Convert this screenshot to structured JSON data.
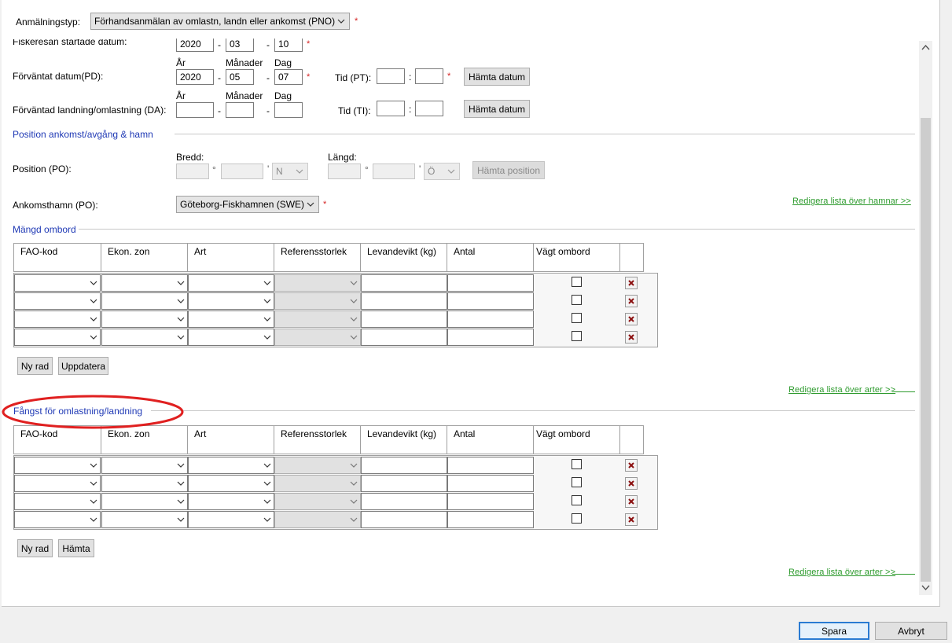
{
  "header": {
    "type_label": "Anmälningstyp:",
    "type_value": "Förhandsanmälan av omlastn, landn eller ankomst (PNO)"
  },
  "start_date": {
    "label": "Fiskeresan startade datum:",
    "year": "2020",
    "month": "03",
    "day": "10"
  },
  "date_labels": {
    "year": "År",
    "month": "Månader",
    "day": "Dag"
  },
  "expected_date": {
    "label": "Förväntat datum(PD):",
    "year": "2020",
    "month": "05",
    "day": "07",
    "time_label": "Tid (PT):",
    "fetch_button": "Hämta datum"
  },
  "expected_landing": {
    "label": "Förväntad landning/omlastning (DA):",
    "time_label": "Tid (TI):",
    "fetch_button": "Hämta datum"
  },
  "position_section": {
    "title": "Position ankomst/avgång & hamn",
    "position_label": "Position (PO):",
    "lat_label": "Bredd:",
    "lat_dir": "N",
    "lon_label": "Längd:",
    "lon_dir": "Ö",
    "fetch_button": "Hämta position",
    "degree": "°",
    "minute": "'",
    "port_label": "Ankomsthamn (PO):",
    "port_value": "Göteborg-Fiskhamnen (SWE)",
    "edit_ports_link": "Redigera lista över hamnar >>"
  },
  "required_mark": "*",
  "separators": {
    "dash": "-",
    "colon": ":"
  },
  "onboard_section": {
    "title": "Mängd ombord",
    "columns": [
      "FAO-kod",
      "Ekon. zon",
      "Art",
      "Referensstorlek",
      "Levandevikt (kg)",
      "Antal",
      "Vägt ombord"
    ],
    "rows": 4,
    "new_row_button": "Ny rad",
    "update_button": "Uppdatera",
    "edit_species_link": "Redigera lista över arter >>"
  },
  "catch_section": {
    "title": "Fångst för omlastning/landning",
    "columns": [
      "FAO-kod",
      "Ekon. zon",
      "Art",
      "Referensstorlek",
      "Levandevikt (kg)",
      "Antal",
      "Vägt ombord"
    ],
    "rows": 4,
    "new_row_button": "Ny rad",
    "fetch_button": "Hämta",
    "edit_species_link": "Redigera lista över arter >>"
  },
  "footer": {
    "save_button": "Spara",
    "cancel_button": "Avbryt"
  },
  "colors": {
    "accent_blue": "#1f39b5",
    "required_red": "#d42020",
    "link_green": "#2c9a2c",
    "annotation_red": "#e02020"
  }
}
